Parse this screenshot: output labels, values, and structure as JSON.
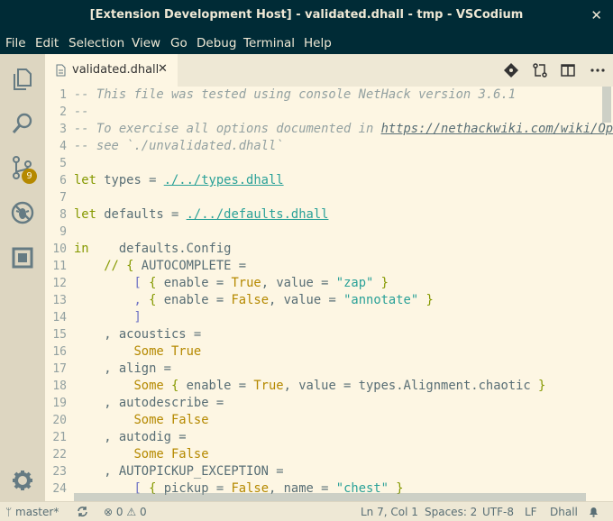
{
  "window": {
    "title": "[Extension Development Host] - validated.dhall - tmp - VSCodium"
  },
  "menu": [
    "File",
    "Edit",
    "Selection",
    "View",
    "Go",
    "Debug",
    "Terminal",
    "Help"
  ],
  "activity": {
    "scm_badge": "9"
  },
  "tab": {
    "label": "validated.dhall"
  },
  "gutter": [
    "1",
    "2",
    "3",
    "4",
    "5",
    "6",
    "7",
    "8",
    "9",
    "10",
    "11",
    "12",
    "13",
    "14",
    "15",
    "16",
    "17",
    "18",
    "19",
    "20",
    "21",
    "22",
    "23",
    "24"
  ],
  "code": {
    "l1": "-- This file was tested using console NetHack version 3.6.1",
    "l2": "--",
    "l3a": "-- To exercise all options documented in ",
    "l3b": "https://nethackwiki.com/wiki/Options",
    "l4": "-- see `./unvalidated.dhall`",
    "l6a": "let",
    "l6b": " types = ",
    "l6c": "./../types.dhall",
    "l8a": "let",
    "l8b": " defaults = ",
    "l8c": "./../defaults.dhall",
    "l10a": "in",
    "l10b": "    defaults.Config",
    "l11a": "    ",
    "l11b": "//",
    "l11c": " { ",
    "l11d": "AUTOCOMPLETE =",
    "l12a": "        [ ",
    "l12b": "{ ",
    "l12c": "enable = ",
    "l12d": "True",
    "l12e": ", value = ",
    "l12f": "\"zap\"",
    "l12g": " }",
    "l13a": "        , ",
    "l13b": "{ ",
    "l13c": "enable = ",
    "l13d": "False",
    "l13e": ", value = ",
    "l13f": "\"annotate\"",
    "l13g": " }",
    "l14": "        ]",
    "l15": "    , acoustics =",
    "l16a": "        ",
    "l16b": "Some True",
    "l17": "    , align =",
    "l18a": "        ",
    "l18b": "Some",
    "l18c": " { ",
    "l18d": "enable = ",
    "l18e": "True",
    "l18f": ", value = types.Alignment.chaotic ",
    "l18g": "}",
    "l19": "    , autodescribe =",
    "l20a": "        ",
    "l20b": "Some False",
    "l21": "    , autodig =",
    "l22a": "        ",
    "l22b": "Some False",
    "l23": "    , AUTOPICKUP_EXCEPTION =",
    "l24a": "        [ ",
    "l24b": "{ ",
    "l24c": "pickup = ",
    "l24d": "False",
    "l24e": ", name = ",
    "l24f": "\"chest\"",
    "l24g": " }"
  },
  "status": {
    "branch": "master*",
    "errors": "0",
    "warnings": "0",
    "position": "Ln 7, Col 1",
    "spaces": "Spaces: 2",
    "encoding": "UTF-8",
    "eol": "LF",
    "language": "Dhall"
  }
}
